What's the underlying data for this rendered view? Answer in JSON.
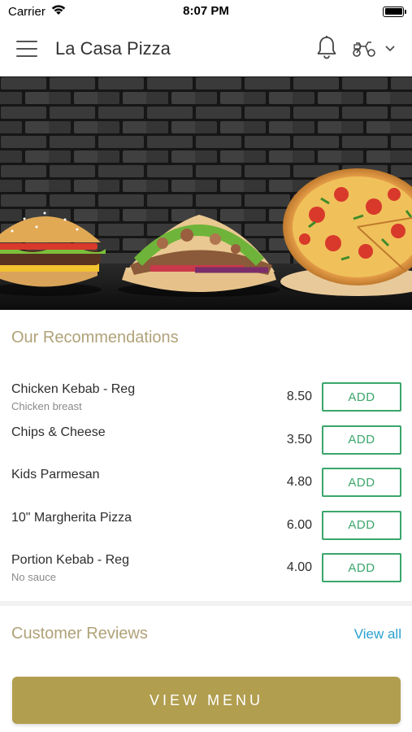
{
  "status_bar": {
    "carrier": "Carrier",
    "time": "8:07 PM"
  },
  "nav": {
    "title": "La Casa Pizza"
  },
  "recommendations": {
    "title": "Our Recommendations",
    "items": [
      {
        "name": "Chicken Kebab - Reg",
        "description": "Chicken breast",
        "price": "8.50",
        "button": "ADD"
      },
      {
        "name": "Chips & Cheese",
        "description": "",
        "price": "3.50",
        "button": "ADD"
      },
      {
        "name": "Kids Parmesan",
        "description": "",
        "price": "4.80",
        "button": "ADD"
      },
      {
        "name": "10\" Margherita Pizza",
        "description": "",
        "price": "6.00",
        "button": "ADD"
      },
      {
        "name": "Portion Kebab - Reg",
        "description": "No sauce",
        "price": "4.00",
        "button": "ADD"
      }
    ]
  },
  "reviews": {
    "title": "Customer Reviews",
    "view_all": "View all"
  },
  "footer": {
    "view_menu": "VIEW MENU"
  },
  "colors": {
    "accent_gold": "#b19e4f",
    "add_green": "#3aa66b",
    "link_blue": "#2a9fd0"
  },
  "icons": [
    "wifi-icon",
    "battery-icon",
    "menu-icon",
    "bell-icon",
    "scooter-icon",
    "chevron-down-icon"
  ]
}
